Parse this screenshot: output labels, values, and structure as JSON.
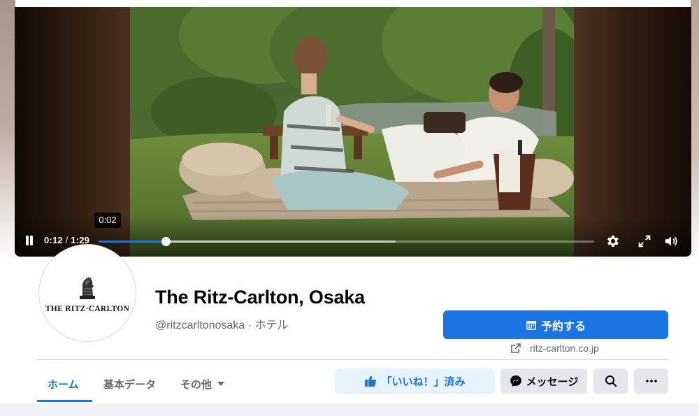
{
  "video": {
    "current_time": "0:12",
    "separator": " / ",
    "duration": "1:29",
    "hover_tooltip": "0:02",
    "progress_fraction": 0.136,
    "buffered_fraction": 0.6,
    "accent_color": "#1b74e4"
  },
  "page": {
    "avatar_text": "THE RITZ·CARLTON",
    "name": "The Ritz-Carlton, Osaka",
    "subtitle": "@ritzcarltonosaka · ホテル",
    "reserve_label": "予約する",
    "website": "ritz-carlton.co.jp"
  },
  "tabs": [
    {
      "label": "ホーム",
      "active": true
    },
    {
      "label": "基本データ",
      "active": false
    },
    {
      "label": "その他",
      "active": false
    }
  ],
  "actions": {
    "like_label": "「いいね！」済み",
    "message_label": "メッセージ"
  },
  "icons": {
    "pause": "pause-icon",
    "settings": "gear-icon",
    "fullscreen": "fullscreen-icon",
    "volume": "volume-icon",
    "reserve": "calendar-icon",
    "website": "external-link-icon",
    "like": "thumbs-up-icon",
    "message": "messenger-icon",
    "search": "search-icon",
    "more": "more-dots-icon"
  }
}
